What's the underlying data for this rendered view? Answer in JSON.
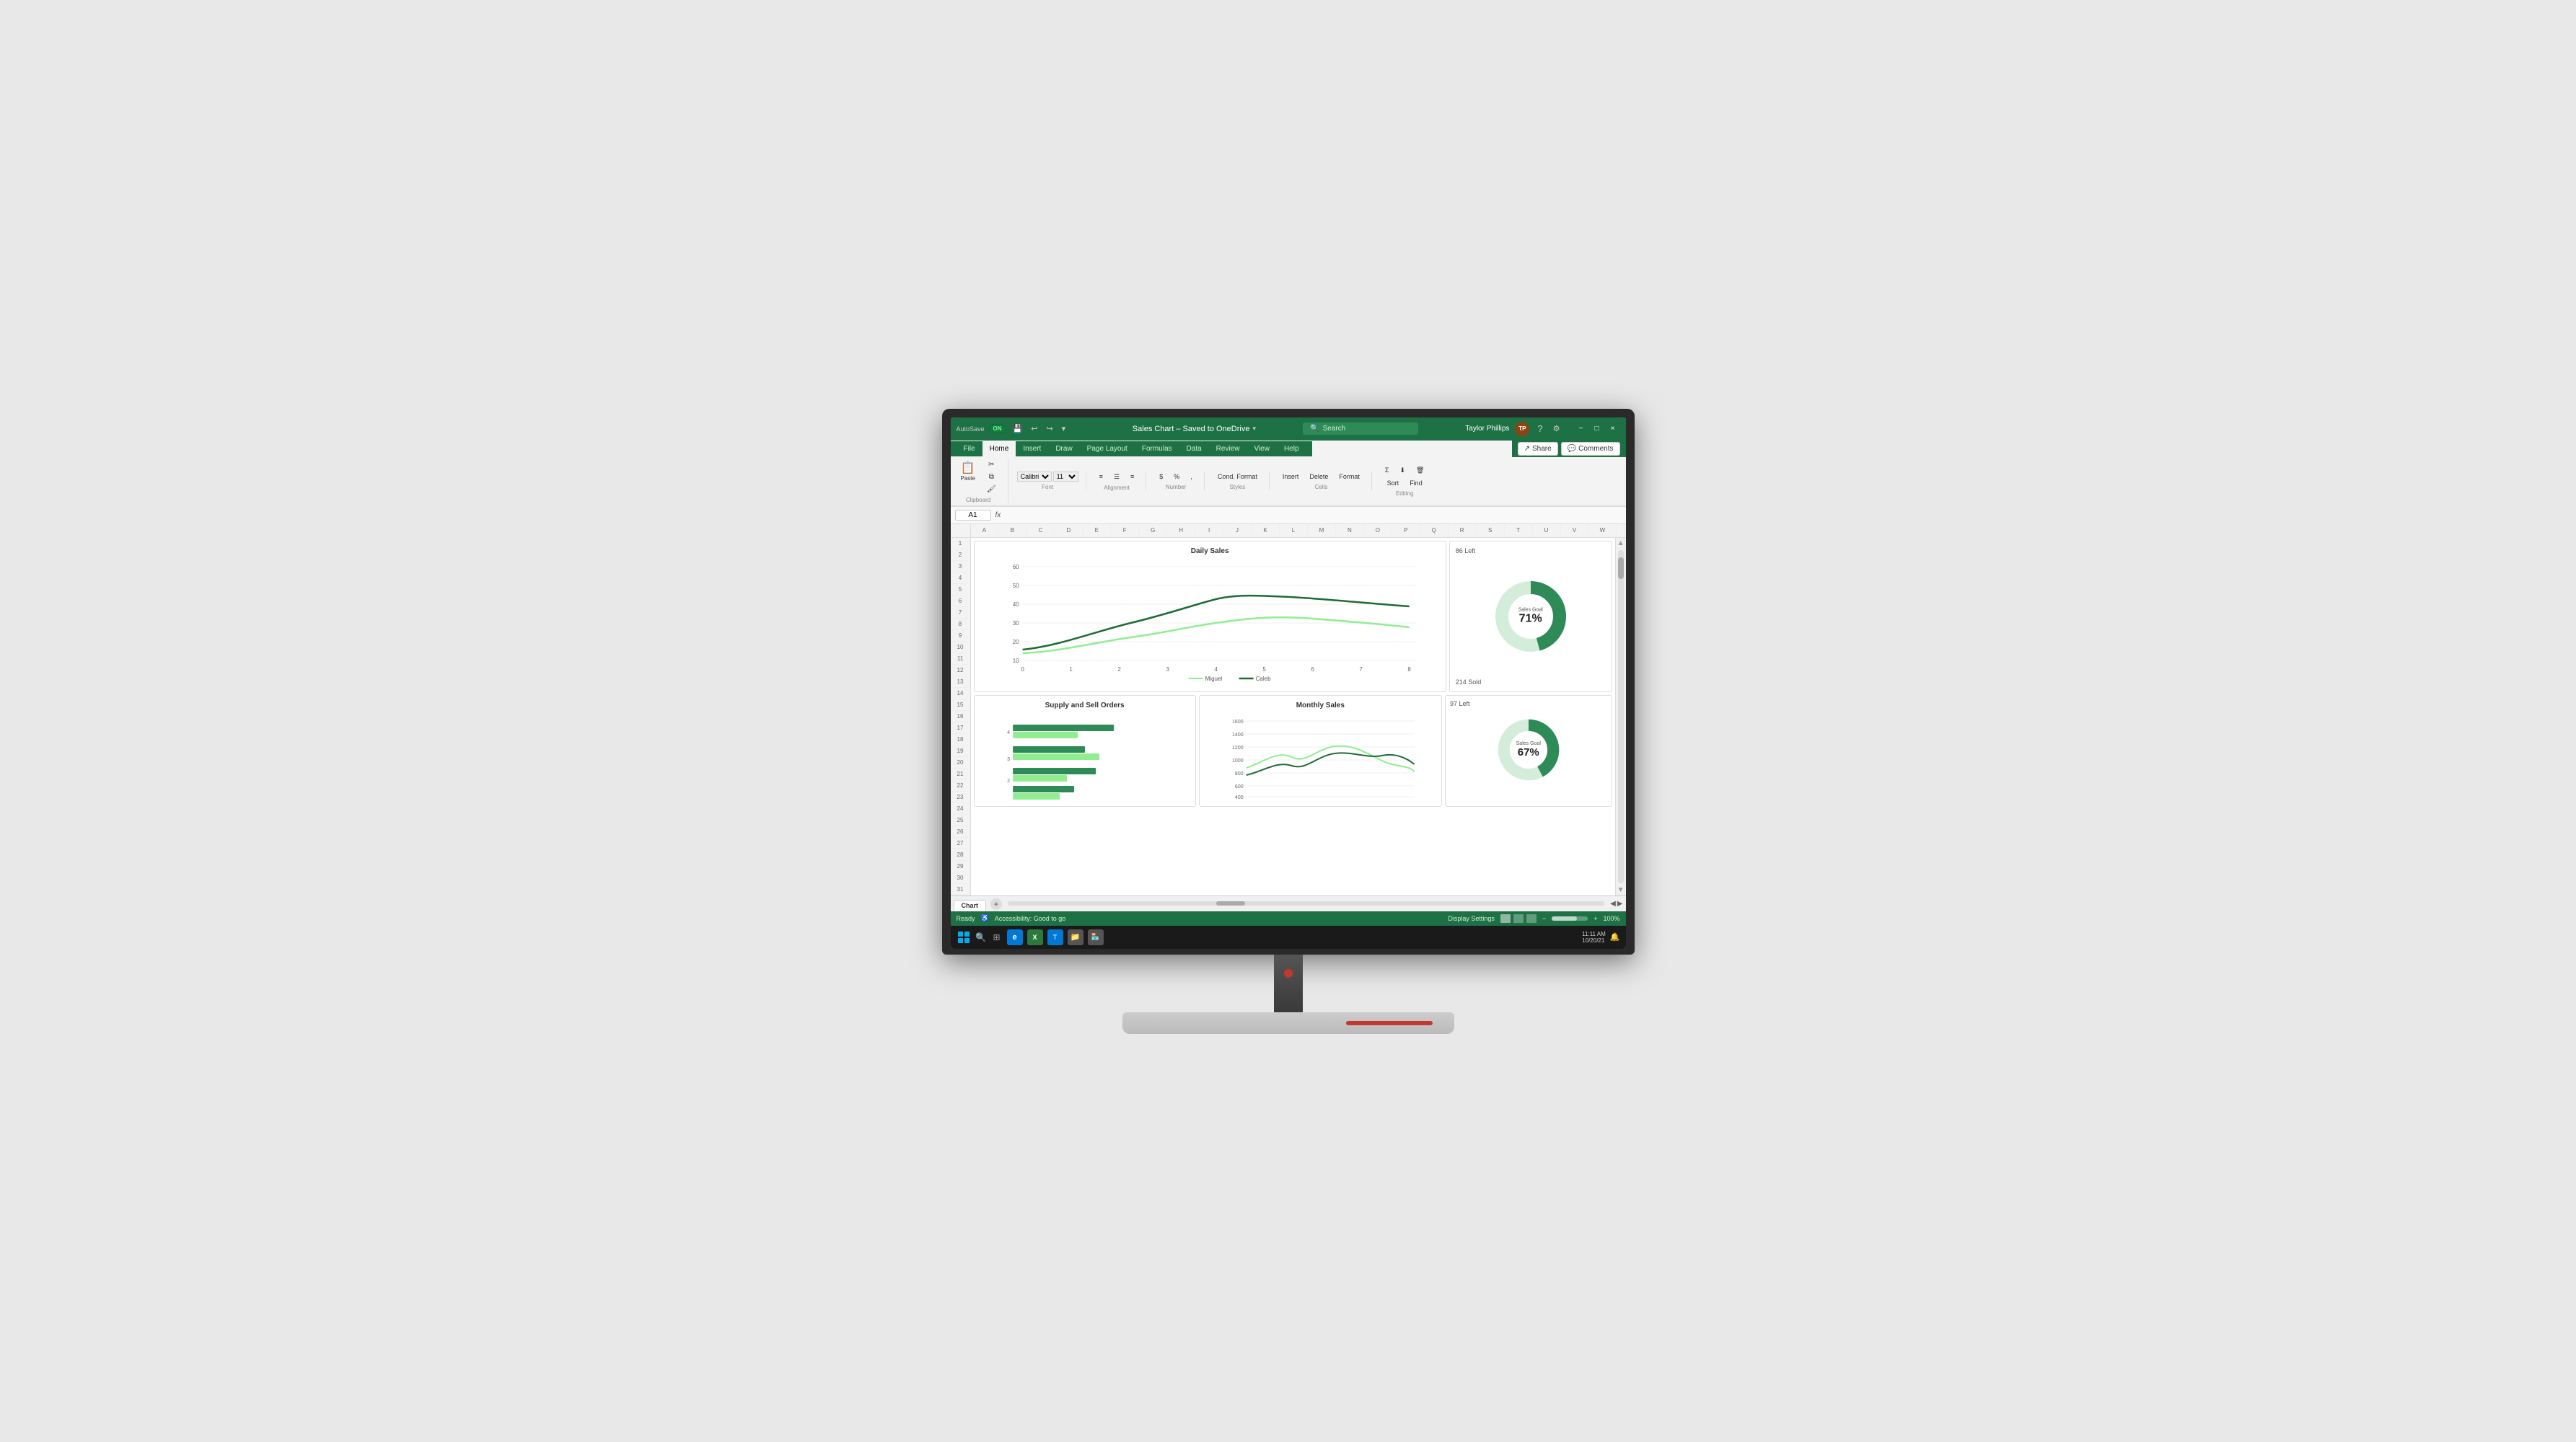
{
  "app": {
    "title": "Sales Chart – Saved to OneDrive",
    "autosave_label": "AutoSave",
    "autosave_state": "ON"
  },
  "titlebar": {
    "user_name": "Taylor Phillips",
    "search_placeholder": "Search"
  },
  "ribbon": {
    "tabs": [
      "File",
      "Home",
      "Insert",
      "Draw",
      "Page Layout",
      "Formulas",
      "Data",
      "Review",
      "View",
      "Help"
    ],
    "active_tab": "Home",
    "share_label": "Share",
    "comments_label": "Comments"
  },
  "formula_bar": {
    "cell_ref": "A1",
    "fx_label": "fx"
  },
  "col_headers": [
    "A",
    "B",
    "C",
    "D",
    "E",
    "F",
    "G",
    "H",
    "I",
    "J",
    "K",
    "L",
    "M",
    "N",
    "O",
    "P",
    "Q",
    "R",
    "S",
    "T",
    "U",
    "V",
    "W"
  ],
  "row_headers": [
    "1",
    "2",
    "3",
    "4",
    "5",
    "6",
    "7",
    "8",
    "9",
    "10",
    "11",
    "12",
    "13",
    "14",
    "15",
    "16",
    "17",
    "18",
    "19",
    "20",
    "21",
    "22",
    "23",
    "24",
    "25",
    "26",
    "27",
    "28",
    "29",
    "30",
    "31"
  ],
  "charts": {
    "daily_sales": {
      "title": "Daily Sales",
      "legend": [
        "Miguel",
        "Caleb"
      ],
      "y_axis": [
        "60",
        "50",
        "40",
        "30",
        "20",
        "10"
      ],
      "x_axis": [
        "0",
        "1",
        "2",
        "3",
        "4",
        "5",
        "6",
        "7",
        "8"
      ]
    },
    "donut1": {
      "left_label": "86 Left",
      "bottom_label": "214 Sold",
      "center_label": "Sales Goal",
      "percent": "71%",
      "filled_pct": 71,
      "color_filled": "#2e8b57",
      "color_bg": "#d4edda"
    },
    "supply_orders": {
      "title": "Supply and Sell Orders",
      "bars": [
        4,
        3,
        3,
        2,
        2
      ],
      "colors": [
        "#2e8b57",
        "#90ee90",
        "#2e8b57",
        "#90ee90",
        "#2e8b57"
      ]
    },
    "monthly_sales": {
      "title": "Monthly Sales",
      "y_axis": [
        "1600",
        "1400",
        "1200",
        "1000",
        "800",
        "600",
        "400"
      ],
      "x_axis": []
    },
    "donut2": {
      "left_label": "97 Left",
      "bottom_label": "",
      "center_label": "Sales Goal",
      "percent": "67%",
      "filled_pct": 67,
      "color_filled": "#2e8b57",
      "color_bg": "#d4edda"
    }
  },
  "sheet_tabs": {
    "tabs": [
      "Chart"
    ],
    "active": "Chart",
    "add_label": "+"
  },
  "status_bar": {
    "ready": "Ready",
    "accessibility": "Accessibility: Good to go",
    "display_settings": "Display Settings",
    "zoom": "100%"
  },
  "taskbar": {
    "time": "11:11 AM",
    "date": "10/20/21"
  },
  "window_controls": {
    "minimize": "−",
    "maximize": "□",
    "close": "×"
  }
}
